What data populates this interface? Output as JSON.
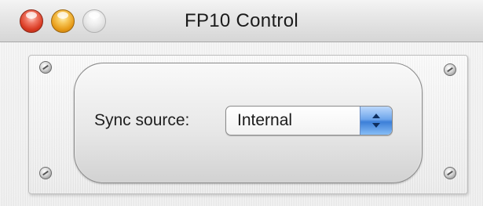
{
  "window": {
    "title": "FP10 Control"
  },
  "controls": {
    "window_buttons": [
      "close",
      "minimize",
      "zoom"
    ],
    "sync_source": {
      "label": "Sync source:",
      "selected": "Internal"
    }
  },
  "icons": {
    "close": "close-icon",
    "minimize": "minimize-icon",
    "zoom": "zoom-icon",
    "popup": "up-down-arrows-icon",
    "screw": "screw-icon"
  },
  "colors": {
    "close": "#d93a22",
    "minimize": "#e79b18",
    "zoom": "#d6d6d6",
    "popup_accent": "#3c7fd8"
  }
}
